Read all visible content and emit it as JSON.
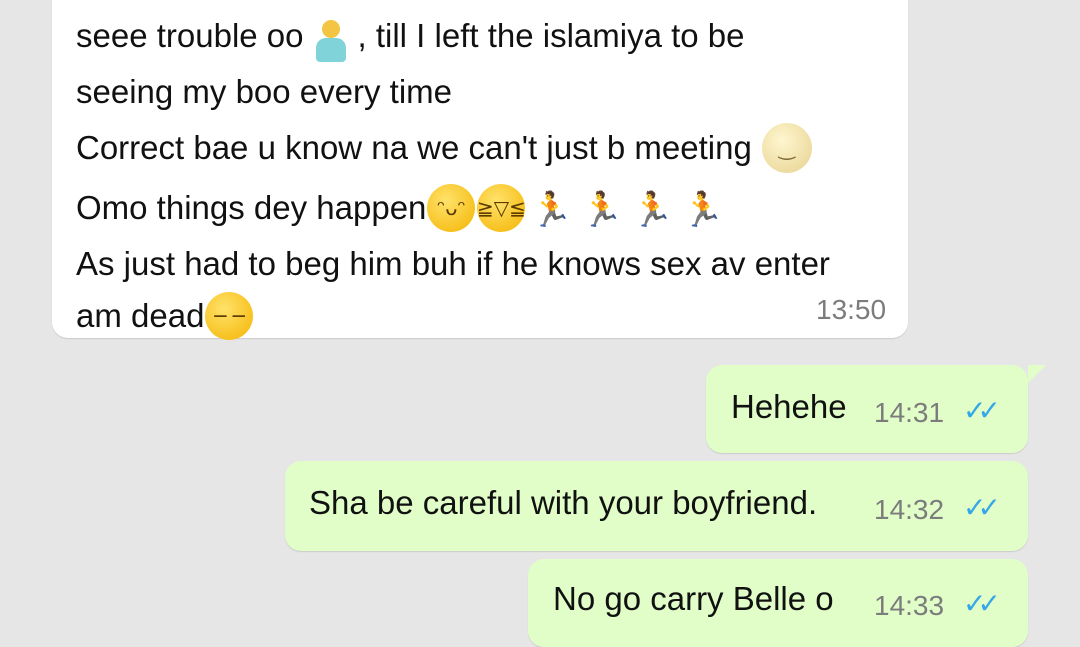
{
  "colors": {
    "background": "#e6e6e6",
    "incoming_bubble": "#ffffff",
    "outgoing_bubble": "#e1fec8",
    "timestamp": "#7c7c7c",
    "read_ticks": "#35a7e8"
  },
  "messages": [
    {
      "direction": "incoming",
      "lines": [
        {
          "parts": [
            "seee trouble oo",
            ", till I left the islamiya to be"
          ],
          "emoji": "person-shrugging"
        },
        {
          "text": "seeing my boo every time"
        },
        {
          "text": "Correct bae u know na we can't just b meeting",
          "emoji": "full-moon-face"
        },
        {
          "text": "Omo things dey happen",
          "emoji": "grinning-sweat, tears-of-joy, 4x woman-running"
        },
        {
          "text": "As just had to beg him buh if he knows sex av enter"
        },
        {
          "text": "am dead",
          "emoji": "expressionless-face"
        }
      ],
      "time": "13:50"
    },
    {
      "direction": "outgoing",
      "text": "Hehehe",
      "time": "14:31",
      "status": "read",
      "status_icon": "double-check-icon"
    },
    {
      "direction": "outgoing",
      "text": "Sha be careful with your boyfriend.",
      "time": "14:32",
      "status": "read",
      "status_icon": "double-check-icon"
    },
    {
      "direction": "outgoing",
      "text": "No go carry Belle o",
      "time": "14:33",
      "status": "read",
      "status_icon": "double-check-icon"
    }
  ]
}
